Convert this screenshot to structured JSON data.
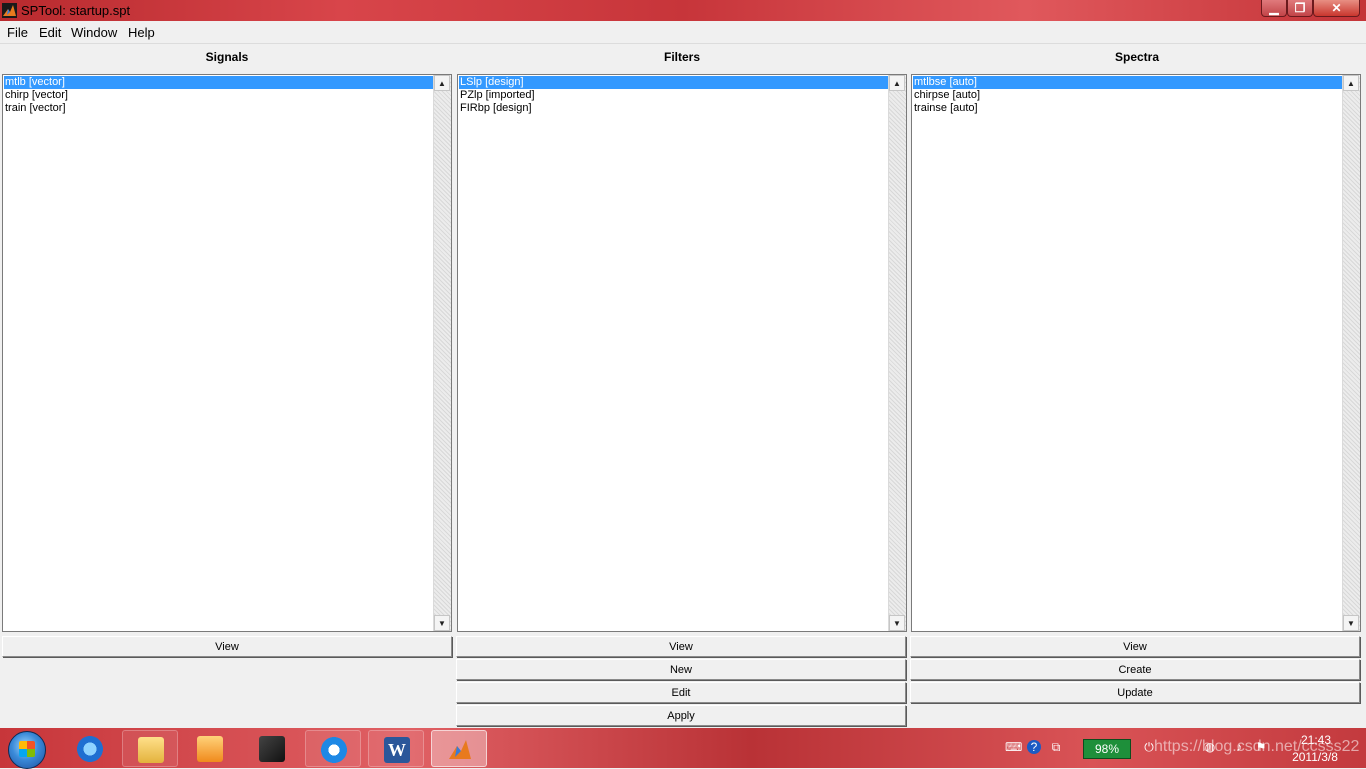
{
  "window": {
    "title": "SPTool: startup.spt",
    "min_glyph": "▁",
    "max_glyph": "❐",
    "close_glyph": "✕"
  },
  "menu": [
    "File",
    "Edit",
    "Window",
    "Help"
  ],
  "panels": {
    "signals": {
      "title": "Signals",
      "items": [
        "mtlb [vector]",
        "chirp [vector]",
        "train [vector]"
      ],
      "selected_index": 0,
      "buttons": [
        "View"
      ]
    },
    "filters": {
      "title": "Filters",
      "items": [
        "LSlp [design]",
        "PZlp [imported]",
        "FIRbp [design]"
      ],
      "selected_index": 0,
      "buttons": [
        "View",
        "New",
        "Edit",
        "Apply"
      ]
    },
    "spectra": {
      "title": "Spectra",
      "items": [
        "mtlbse [auto]",
        "chirpse [auto]",
        "trainse [auto]"
      ],
      "selected_index": 0,
      "buttons": [
        "View",
        "Create",
        "Update"
      ]
    }
  },
  "scroll_glyphs": {
    "up": "▲",
    "down": "▼"
  },
  "taskbar": {
    "apps": [
      "internet-explorer",
      "file-explorer",
      "media-player",
      "scanner",
      "sogou",
      "word",
      "matlab"
    ],
    "word_letter": "W",
    "battery": "98%",
    "time": "21:43",
    "date": "2011/3/8",
    "watermark": "https://blog.csdn.net/ccsss22"
  }
}
